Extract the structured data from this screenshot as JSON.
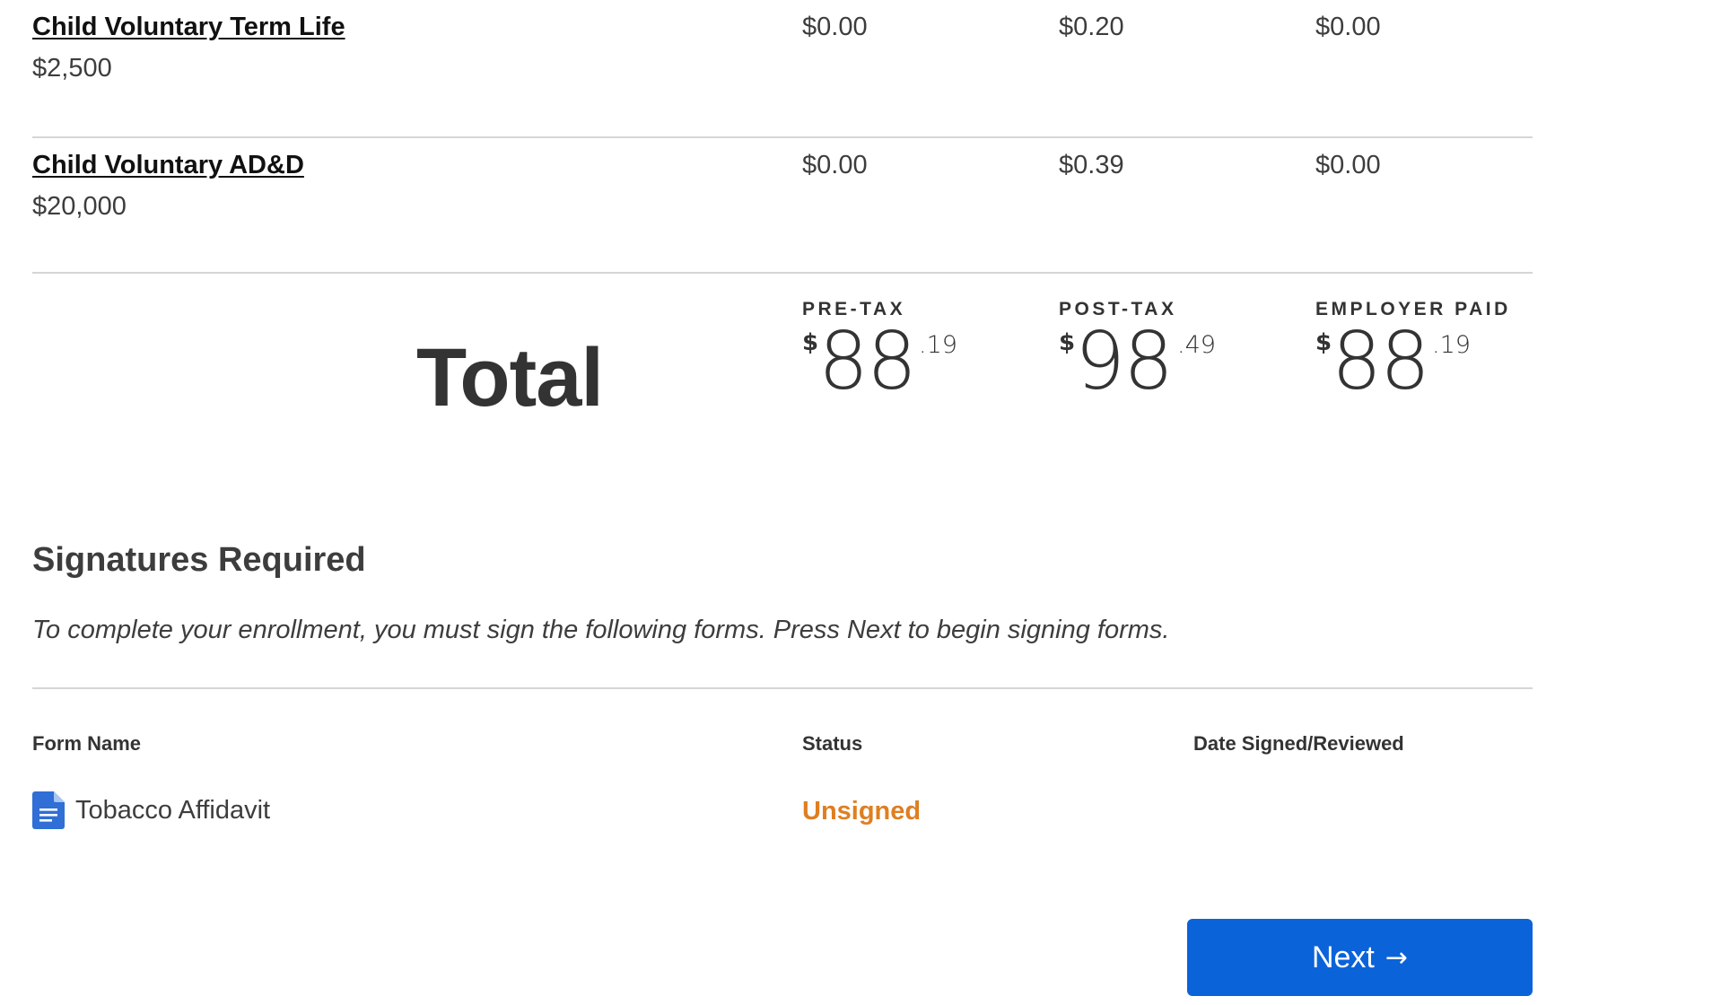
{
  "benefits": [
    {
      "name": "Child Voluntary Term Life",
      "amount": "$2,500",
      "pre_tax": "$0.00",
      "post_tax": "$0.20",
      "employer_paid": "$0.00"
    },
    {
      "name": "Child Voluntary AD&D",
      "amount": "$20,000",
      "pre_tax": "$0.00",
      "post_tax": "$0.39",
      "employer_paid": "$0.00"
    }
  ],
  "totals": {
    "label": "Total",
    "pre_tax": {
      "heading": "PRE-TAX",
      "currency": "$",
      "dollars": "88",
      "cents": ".19"
    },
    "post_tax": {
      "heading": "POST-TAX",
      "currency": "$",
      "dollars": "98",
      "cents": ".49"
    },
    "employer_paid": {
      "heading": "EMPLOYER PAID",
      "currency": "$",
      "dollars": "88",
      "cents": ".19"
    }
  },
  "signatures": {
    "title": "Signatures Required",
    "description": "To complete your enrollment, you must sign the following forms. Press Next to begin signing forms.",
    "columns": {
      "form_name": "Form Name",
      "status": "Status",
      "date_signed": "Date Signed/Reviewed"
    },
    "forms": [
      {
        "icon": "document-icon",
        "name": "Tobacco Affidavit",
        "status": "Unsigned",
        "date_signed": ""
      }
    ]
  },
  "next_button": {
    "label": "Next",
    "icon": "arrow-right-icon"
  },
  "colors": {
    "status_unsigned": "#de7f22",
    "primary_button": "#0b63d9",
    "document_icon": "#2f6fd6"
  }
}
